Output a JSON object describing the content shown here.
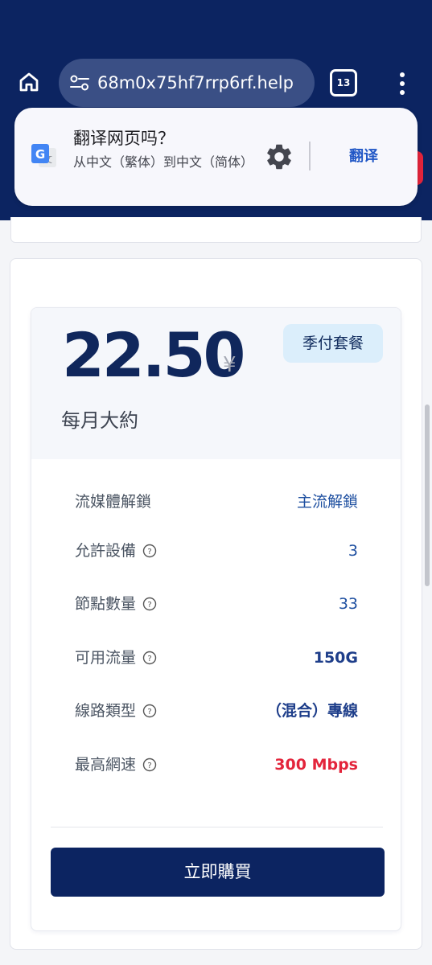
{
  "browser": {
    "url": "68m0x75hf7rrp6rf.help",
    "tab_count": "13"
  },
  "translate": {
    "title": "翻译网页吗？",
    "subtitle": "从中文（繁体）到中文（简体）",
    "action": "翻译",
    "brand_color": "#4285f4"
  },
  "plan": {
    "price": "22.50",
    "currency": "¥",
    "badge": "季付套餐",
    "period": "每月大約",
    "features": [
      {
        "label": "流媒體解鎖",
        "value": "主流解鎖"
      },
      {
        "label": "允許設備",
        "value": "3"
      },
      {
        "label": "節點數量",
        "value": "33"
      },
      {
        "label": "可用流量",
        "value": "150G"
      },
      {
        "label": "線路類型",
        "value": "（混合）專線"
      },
      {
        "label": "最高網速",
        "value": "300 Mbps"
      }
    ],
    "buy_label": "立即購買",
    "colors": {
      "primary": "#0c2461",
      "accent_red": "#e3243b",
      "badge_bg": "#dbeefb"
    }
  }
}
